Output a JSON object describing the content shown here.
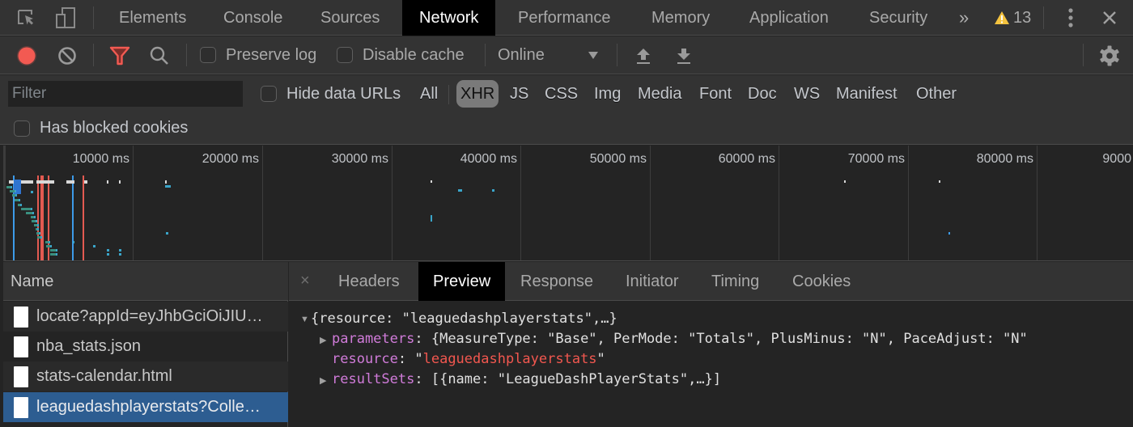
{
  "top_tabs": {
    "icons": {
      "inspect": "inspect-element-icon",
      "device": "device-toolbar-icon"
    },
    "items": [
      {
        "label": "Elements"
      },
      {
        "label": "Console"
      },
      {
        "label": "Sources"
      },
      {
        "label": "Network",
        "active": true
      },
      {
        "label": "Performance"
      },
      {
        "label": "Memory"
      },
      {
        "label": "Application"
      },
      {
        "label": "Security"
      }
    ],
    "more_label": "»",
    "warning_count": "13",
    "colors": {
      "warning": "#f4c33f"
    }
  },
  "toolbar": {
    "record_color": "#f25a52",
    "filter_color": "#f25a52",
    "preserve_log_label": "Preserve log",
    "preserve_log_checked": false,
    "disable_cache_label": "Disable cache",
    "disable_cache_checked": false,
    "throttle_value": "Online"
  },
  "filterbar": {
    "filter_placeholder": "Filter",
    "filter_value": "",
    "hide_data_urls_label": "Hide data URLs",
    "hide_data_urls_checked": false,
    "types": [
      "All",
      "XHR",
      "JS",
      "CSS",
      "Img",
      "Media",
      "Font",
      "Doc",
      "WS",
      "Manifest",
      "Other"
    ],
    "active_type": "XHR",
    "blocked_cookies_label": "Has blocked cookies",
    "blocked_cookies_checked": false
  },
  "overview": {
    "ticks": [
      "10000 ms",
      "20000 ms",
      "30000 ms",
      "40000 ms",
      "50000 ms",
      "60000 ms",
      "70000 ms",
      "80000 ms",
      "9000"
    ],
    "colors": {
      "dom_content_loaded": "#3d9be9",
      "load": "#e35a51",
      "request": "#3aa5c9",
      "waiting": "#3a8f7f"
    }
  },
  "requests": {
    "column_header": "Name",
    "items": [
      {
        "name": "locate?appId=eyJhbGciOiJIU…"
      },
      {
        "name": "nba_stats.json"
      },
      {
        "name": "stats-calendar.html"
      },
      {
        "name": "leaguedashplayerstats?Colle…",
        "selected": true
      }
    ]
  },
  "detail": {
    "close_label": "×",
    "tabs": [
      {
        "label": "Headers"
      },
      {
        "label": "Preview",
        "active": true
      },
      {
        "label": "Response"
      },
      {
        "label": "Initiator"
      },
      {
        "label": "Timing"
      },
      {
        "label": "Cookies"
      }
    ],
    "preview": {
      "root_summary": "{resource: \"leaguedashplayerstats\",…}",
      "lines": [
        {
          "key": "parameters",
          "value": "{MeasureType: \"Base\", PerMode: \"Totals\", PlusMinus: \"N\", PaceAdjust: \"N\"",
          "expandable": true
        },
        {
          "key": "resource",
          "value": "leaguedashplayerstats",
          "is_string": true,
          "expandable": false
        },
        {
          "key": "resultSets",
          "value": "[{name: \"LeagueDashPlayerStats\",…}]",
          "expandable": true
        }
      ]
    }
  }
}
